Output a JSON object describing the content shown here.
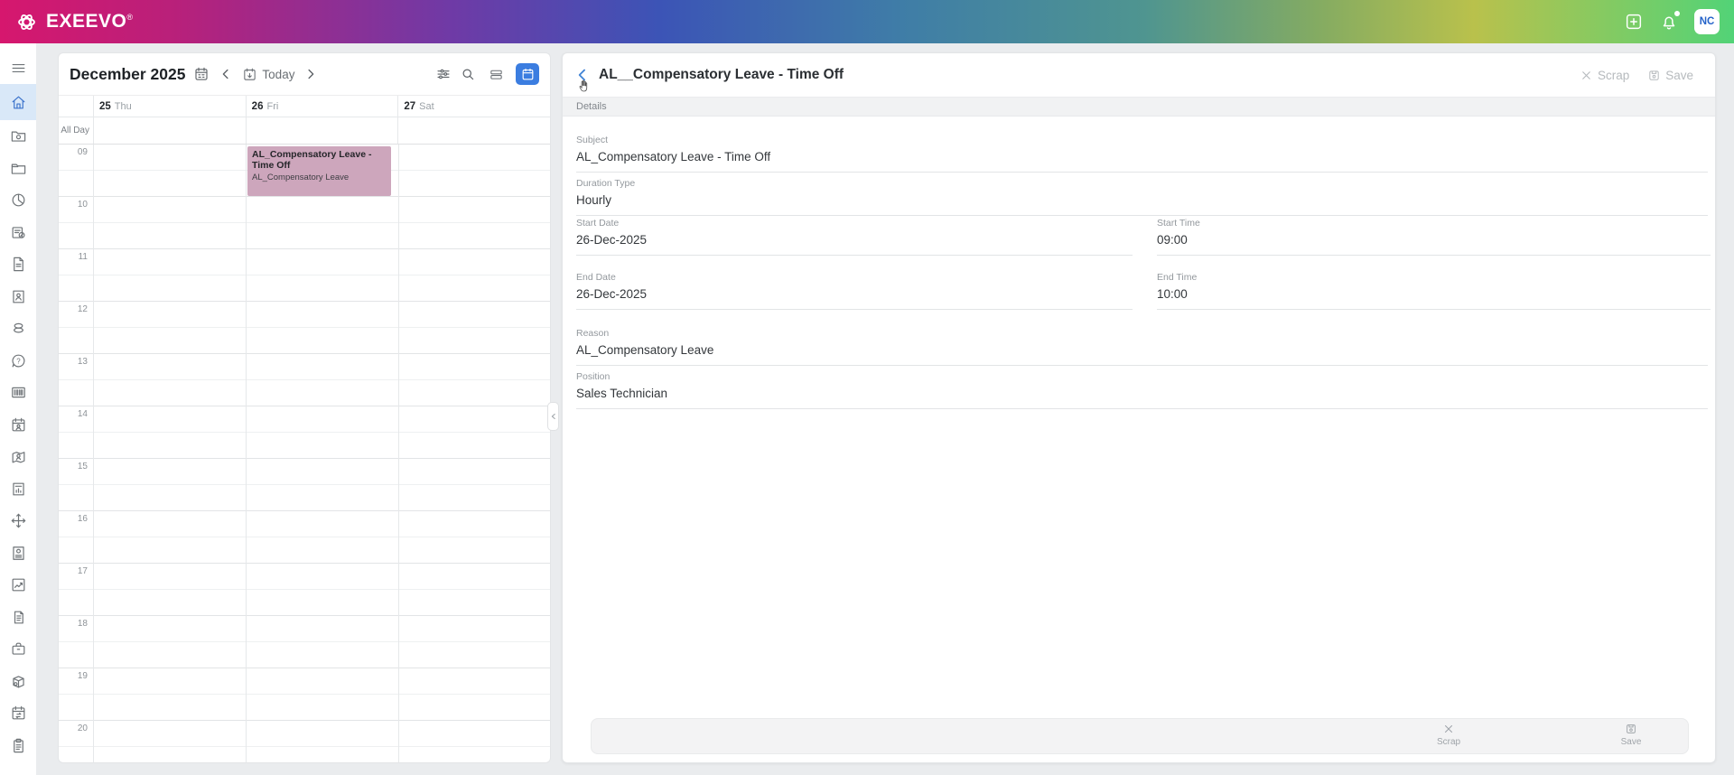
{
  "topbar": {
    "brand": "EXEEVO",
    "registered": "®",
    "avatar_initials": "NC"
  },
  "sidebar": {
    "active_item": "home",
    "items": [
      {
        "icon": "menu"
      },
      {
        "icon": "home",
        "active": true
      },
      {
        "icon": "folder-settings"
      },
      {
        "icon": "folder"
      },
      {
        "icon": "pie-chart"
      },
      {
        "icon": "document-edit"
      },
      {
        "icon": "document"
      },
      {
        "icon": "contact-card"
      },
      {
        "icon": "pills"
      },
      {
        "icon": "help"
      },
      {
        "icon": "barcode"
      },
      {
        "icon": "calendar-user"
      },
      {
        "icon": "map-user"
      },
      {
        "icon": "report-chart"
      },
      {
        "icon": "move"
      },
      {
        "icon": "document-settings"
      },
      {
        "icon": "line-chart"
      },
      {
        "icon": "receipt"
      },
      {
        "icon": "briefcase"
      },
      {
        "icon": "package-settings"
      },
      {
        "icon": "calendar-sync"
      },
      {
        "icon": "clipboard"
      }
    ]
  },
  "calendar": {
    "title": "December 2025",
    "today_label": "Today",
    "all_day_label": "All Day",
    "days": [
      {
        "number": "25",
        "weekday": "Thu"
      },
      {
        "number": "26",
        "weekday": "Fri"
      },
      {
        "number": "27",
        "weekday": "Sat"
      }
    ],
    "hours": [
      "09",
      "10",
      "11",
      "12",
      "13",
      "14",
      "15",
      "16",
      "17",
      "18",
      "19",
      "20"
    ],
    "event": {
      "title": "AL_Compensatory Leave - Time Off",
      "subtitle": "AL_Compensatory Leave",
      "day": "26",
      "start": "09:00",
      "end": "10:00",
      "color": "#cda6bc"
    }
  },
  "details": {
    "title": "AL__Compensatory Leave - Time Off",
    "tab_label": "Details",
    "header_actions": {
      "scrap_label": "Scrap",
      "save_label": "Save"
    },
    "fields": {
      "subject": {
        "label": "Subject",
        "value": "AL_Compensatory Leave - Time Off"
      },
      "duration_type": {
        "label": "Duration Type",
        "value": "Hourly"
      },
      "start_date": {
        "label": "Start Date",
        "value": "26-Dec-2025"
      },
      "start_time": {
        "label": "Start Time",
        "value": "09:00"
      },
      "end_date": {
        "label": "End Date",
        "value": "26-Dec-2025"
      },
      "end_time": {
        "label": "End Time",
        "value": "10:00"
      },
      "reason": {
        "label": "Reason",
        "value": "AL_Compensatory Leave"
      },
      "position": {
        "label": "Position",
        "value": "Sales Technician"
      }
    },
    "footer": {
      "scrap_label": "Scrap",
      "save_label": "Save"
    }
  },
  "colors": {
    "accent_blue": "#3b7de0",
    "event_pink": "#cda6bc",
    "active_nav_bg": "#d9e8f8",
    "topbar_gradient": [
      "#d6176e",
      "#6f3aa6",
      "#3c54b6",
      "#4f9590",
      "#b9c14c",
      "#52d377"
    ]
  }
}
